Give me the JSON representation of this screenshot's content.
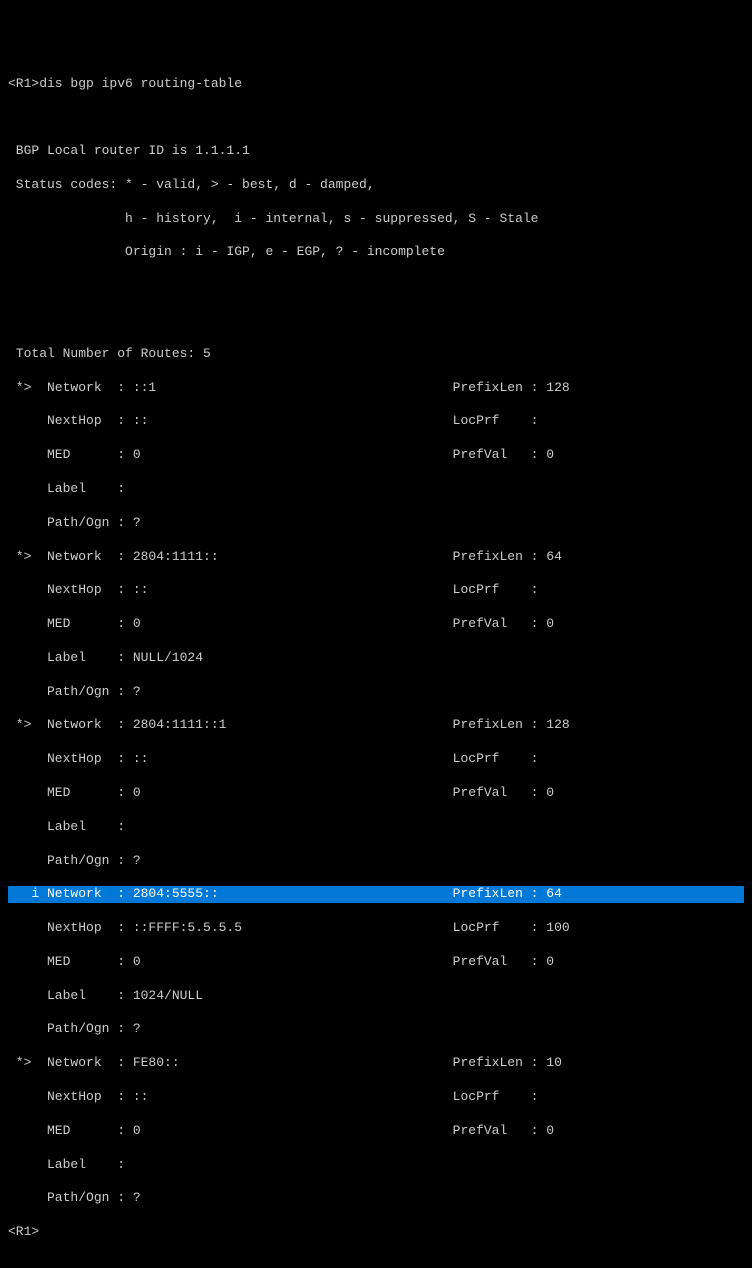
{
  "prompt1": "<R1>dis bgp ipv6 routing-table",
  "blank1": " ",
  "hdr1": " BGP Local router ID is 1.1.1.1",
  "hdr2": " Status codes: * - valid, > - best, d - damped,",
  "hdr3": "               h - history,  i - internal, s - suppressed, S - Stale",
  "hdr4": "               Origin : i - IGP, e - EGP, ? - incomplete",
  "blank2": " ",
  "blank3": " ",
  "total": " Total Number of Routes: 5",
  "r1l1": " *>  Network  : ::1                                      PrefixLen : 128",
  "r1l2": "     NextHop  : ::                                       LocPrf    :",
  "r1l3": "     MED      : 0                                        PrefVal   : 0",
  "r1l4": "     Label    :",
  "r1l5": "     Path/Ogn : ?",
  "r2l1": " *>  Network  : 2804:1111::                              PrefixLen : 64",
  "r2l2": "     NextHop  : ::                                       LocPrf    :",
  "r2l3": "     MED      : 0                                        PrefVal   : 0",
  "r2l4": "     Label    : NULL/1024",
  "r2l5": "     Path/Ogn : ?",
  "r3l1": " *>  Network  : 2804:1111::1                             PrefixLen : 128",
  "r3l2": "     NextHop  : ::                                       LocPrf    :",
  "r3l3": "     MED      : 0                                        PrefVal   : 0",
  "r3l4": "     Label    :",
  "r3l5": "     Path/Ogn : ?",
  "r4l1": "   i Network  : 2804:5555::                              PrefixLen : 64",
  "r4l2": "     NextHop  : ::FFFF:5.5.5.5                           LocPrf    : 100",
  "r4l3": "     MED      : 0                                        PrefVal   : 0",
  "r4l4": "     Label    : 1024/NULL",
  "r4l5": "     Path/Ogn : ?",
  "r5l1": " *>  Network  : FE80::                                   PrefixLen : 10",
  "r5l2": "     NextHop  : ::                                       LocPrf    :",
  "r5l3": "     MED      : 0                                        PrefVal   : 0",
  "r5l4": "     Label    :",
  "r5l5": "     Path/Ogn : ?",
  "prompt2": "<R1>"
}
